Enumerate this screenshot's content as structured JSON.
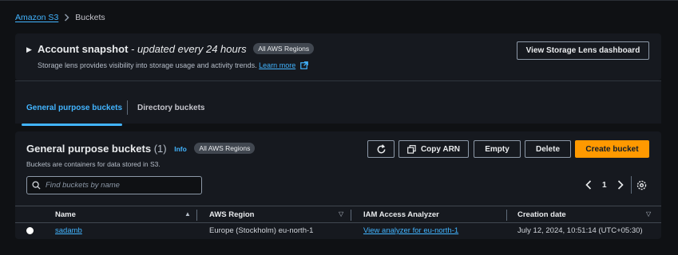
{
  "breadcrumb": {
    "root": "Amazon S3",
    "current": "Buckets"
  },
  "snapshot": {
    "title": "Account snapshot",
    "subtitle": "updated every 24 hours",
    "badge": "All AWS Regions",
    "description": "Storage lens provides visibility into storage usage and activity trends.",
    "learn_more": "Learn more",
    "lens_button": "View Storage Lens dashboard"
  },
  "tabs": [
    {
      "label": "General purpose buckets",
      "active": true
    },
    {
      "label": "Directory buckets",
      "active": false
    }
  ],
  "buckets": {
    "title": "General purpose buckets",
    "count": "(1)",
    "info": "Info",
    "badge": "All AWS Regions",
    "description": "Buckets are containers for data stored in S3.",
    "toolbar": {
      "copy_arn": "Copy ARN",
      "empty": "Empty",
      "delete": "Delete",
      "create": "Create bucket"
    },
    "search_placeholder": "Find buckets by name",
    "page": "1",
    "columns": [
      "Name",
      "AWS Region",
      "IAM Access Analyzer",
      "Creation date"
    ],
    "rows": [
      {
        "name": "sadamb",
        "region": "Europe (Stockholm) eu-north-1",
        "analyzer": "View analyzer for eu-north-1",
        "created": "July 12, 2024, 10:51:14 (UTC+05:30)"
      }
    ]
  },
  "colors": {
    "accent": "#42b4ff",
    "primary_button": "#ff9900",
    "background": "#0f1114",
    "panel": "#16191f"
  }
}
